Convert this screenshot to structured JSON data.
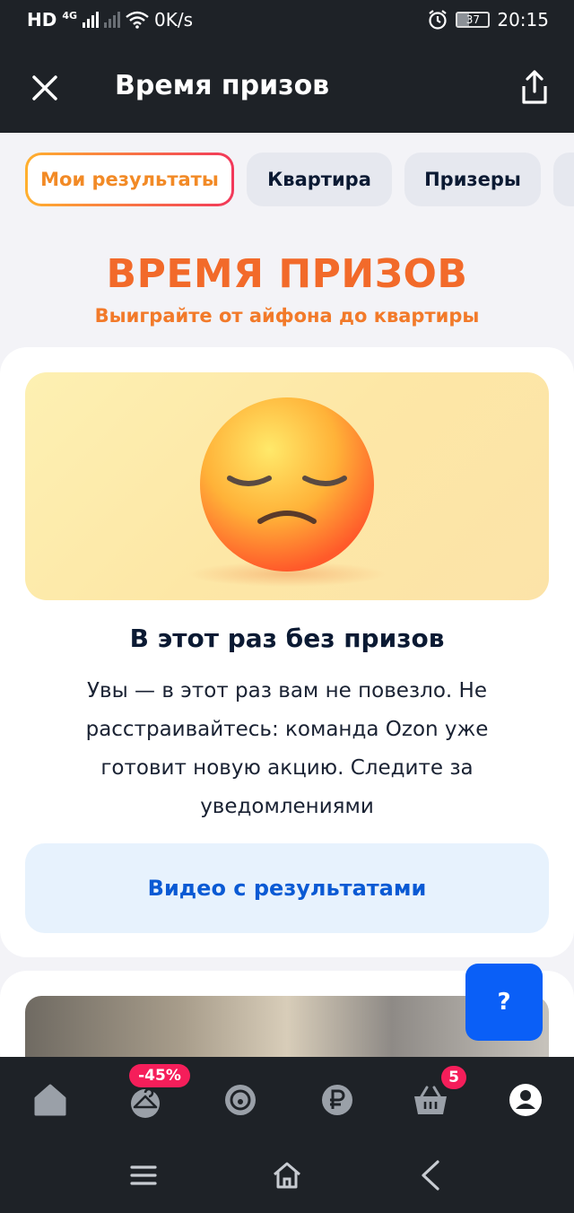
{
  "status": {
    "network": "HD",
    "net_gen": "4G",
    "speed": "0K/s",
    "battery": "37",
    "time": "20:15"
  },
  "appbar": {
    "title": "Время призов"
  },
  "tabs": [
    {
      "label": "Мои результаты",
      "active": true
    },
    {
      "label": "Квартира",
      "active": false
    },
    {
      "label": "Призеры",
      "active": false
    }
  ],
  "hero": {
    "title": "ВРЕМЯ ПРИЗОВ",
    "subtitle": "Выиграйте от айфона до квартиры"
  },
  "result": {
    "title": "В этот раз без призов",
    "text": "Увы — в этот раз вам не повезло. Не расстраивайтесь: команда Ozon уже готовит новую акцию. Следите за уведомлениями",
    "video_button": "Видео с результатами"
  },
  "help": {
    "label": "?"
  },
  "bottom_nav": {
    "discount_badge": "-45%",
    "cart_badge": "5"
  },
  "colors": {
    "brand_blue": "#0a5ff7",
    "accent_orange": "#f26a2a",
    "badge_pink": "#f51e5a",
    "dark_bar": "#1e2227"
  }
}
